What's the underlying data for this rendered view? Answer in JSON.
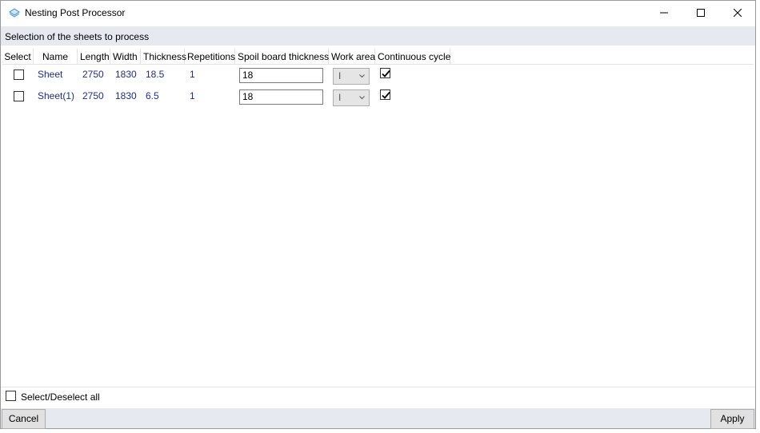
{
  "window": {
    "title": "Nesting Post Processor",
    "icon": "diamond-layers-icon"
  },
  "section": {
    "header": "Selection of the sheets to process"
  },
  "table": {
    "columns": [
      "Select",
      "Name",
      "Length",
      "Width",
      "Thickness",
      "Repetitions",
      "Spoil board thickness",
      "Work area",
      "Continuous cycle"
    ],
    "rows": [
      {
        "selected": false,
        "name": "Sheet",
        "length": "2750",
        "width": "1830",
        "thickness": "18.5",
        "repetitions": "1",
        "spoil_board_thickness": "18",
        "work_area": "I",
        "continuous_cycle": true
      },
      {
        "selected": false,
        "name": "Sheet(1)",
        "length": "2750",
        "width": "1830",
        "thickness": "6.5",
        "repetitions": "1",
        "spoil_board_thickness": "18",
        "work_area": "I",
        "continuous_cycle": true
      }
    ]
  },
  "select_all": {
    "label": "Select/Deselect all",
    "checked": false
  },
  "footer": {
    "cancel_label": "Cancel",
    "apply_label": "Apply"
  },
  "colors": {
    "header_strip": "#e6e9f0",
    "cell_text": "#1f2d8a",
    "icon_accent": "#3b8ed8"
  }
}
